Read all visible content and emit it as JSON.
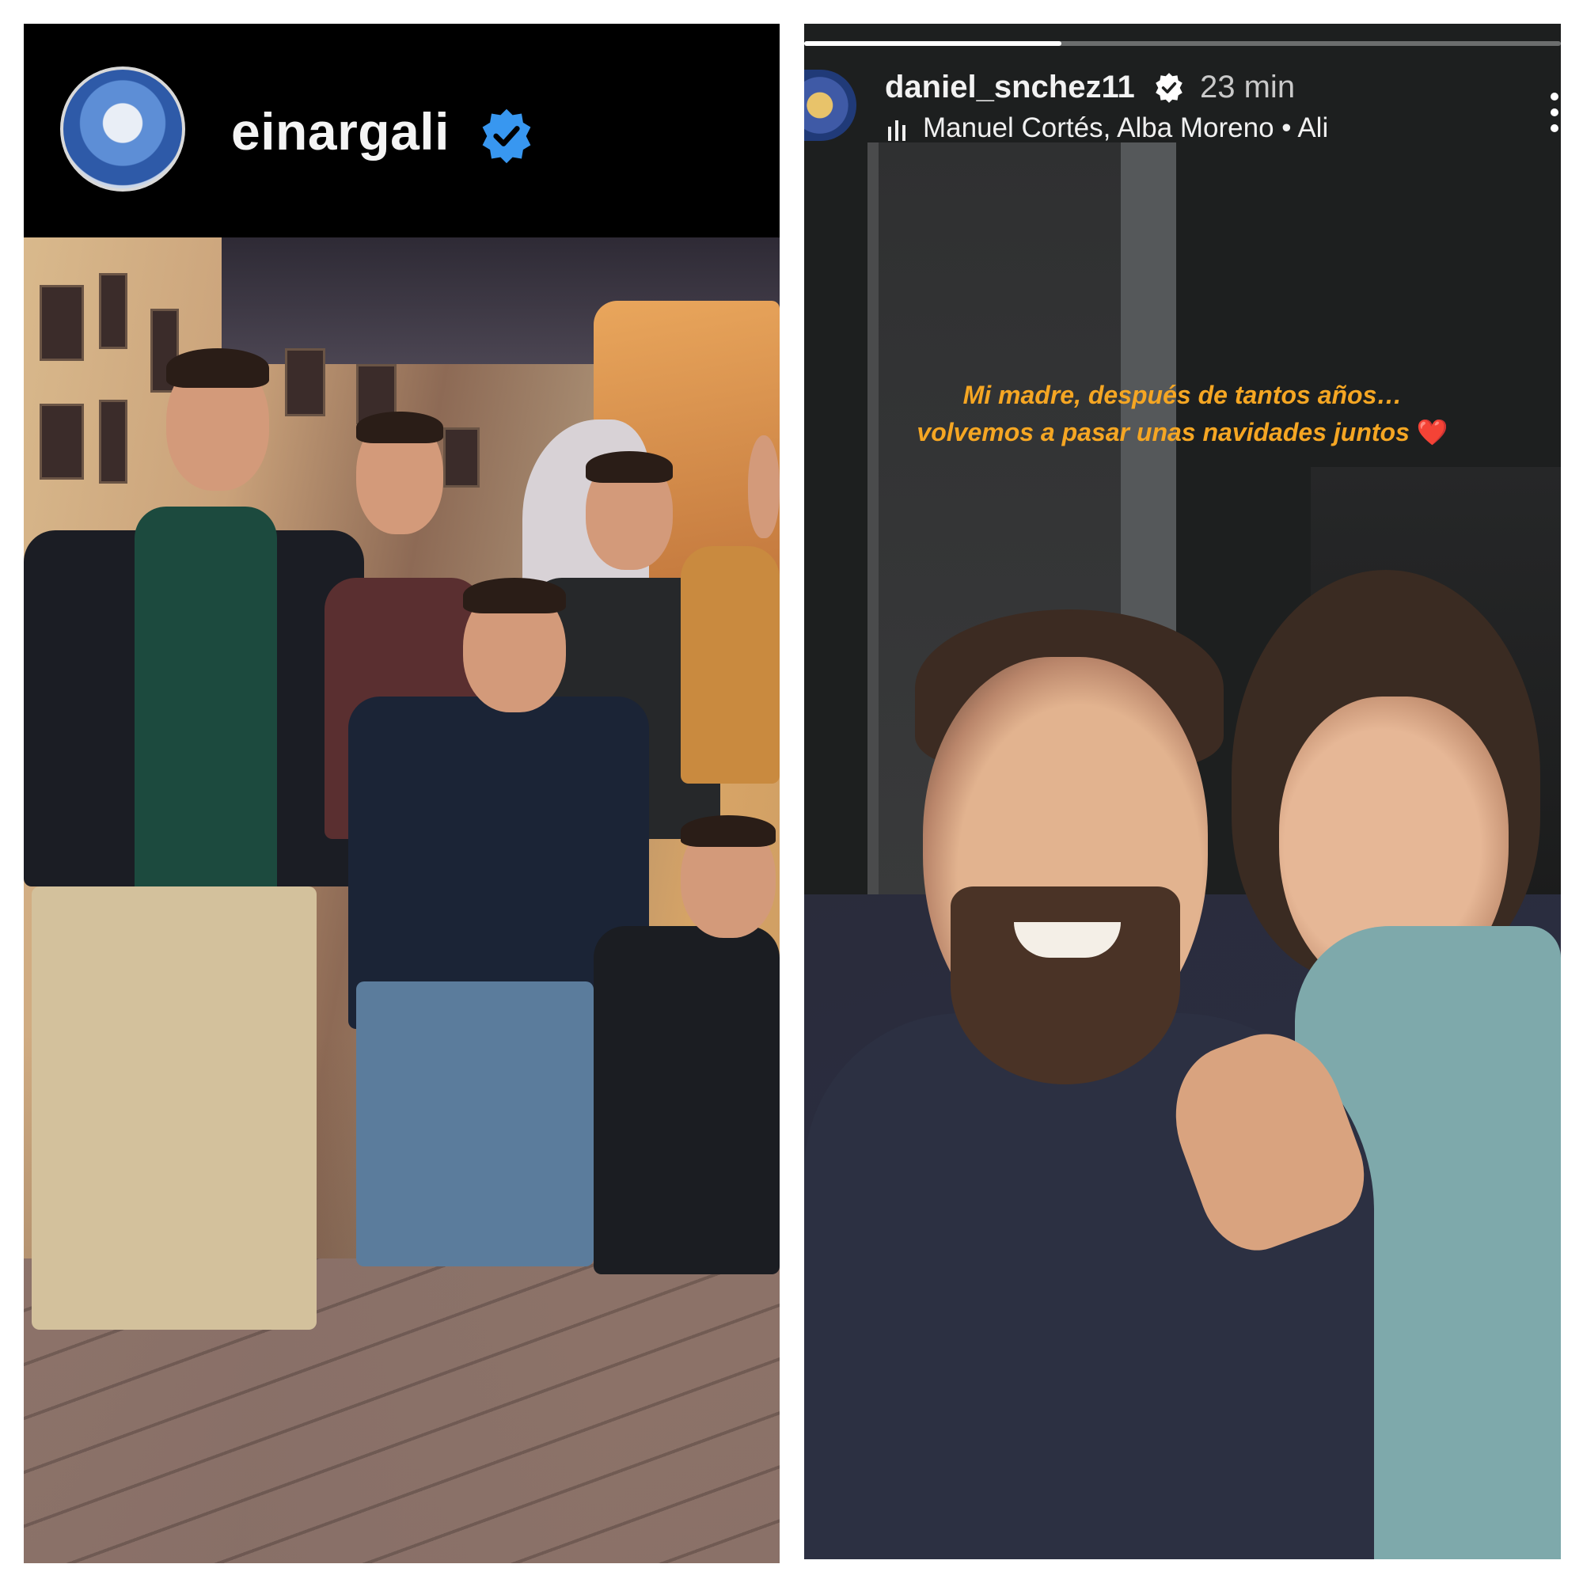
{
  "left_story": {
    "username": "einargali",
    "verified": true,
    "icons": {
      "avatar": "profile-avatar",
      "verified": "verified-badge-icon"
    },
    "colors": {
      "verified_badge": "#3897f0",
      "header_bg": "#000000"
    }
  },
  "right_story": {
    "username": "daniel_snchez11",
    "verified": true,
    "time_ago": "23 min",
    "music": "Manuel Cortés, Alba Moreno • Ali",
    "progress": 0.34,
    "caption_line1": "Mi madre, después de tantos años…",
    "caption_line2": "volvemos a pasar unas navidades juntos",
    "caption_emoji": "❤️",
    "icons": {
      "music": "music-bars-icon",
      "verified": "verified-badge-icon",
      "more": "more-options-icon"
    },
    "colors": {
      "caption": "#f5a623",
      "verified_badge": "#ffffff"
    }
  }
}
